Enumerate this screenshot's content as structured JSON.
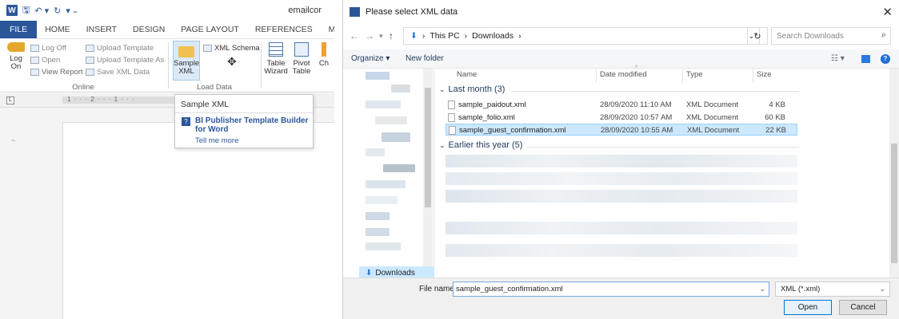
{
  "word": {
    "doc_title": "emailcor",
    "tabs": [
      "FILE",
      "HOME",
      "INSERT",
      "DESIGN",
      "PAGE LAYOUT",
      "REFERENCES",
      "MAILINGS"
    ],
    "ribbon": {
      "log_on": "Log\nOn",
      "log_off": "Log Off",
      "open": "Open",
      "view_report": "View Report",
      "upload_template": "Upload Template",
      "upload_template_as": "Upload Template As",
      "save_xml_data": "Save XML Data",
      "online_label": "Online",
      "sample_xml": "Sample\nXML",
      "xml_schema": "XML Schema",
      "load_data_label": "Load Data",
      "table_wizard": "Table\nWizard",
      "pivot_table": "Pivot\nTable",
      "chart": "Ch"
    },
    "ruler_text": "1 · · · 2 · · · 1 · · ·",
    "tooltip": {
      "title": "Sample XML",
      "link": "BI Publisher Template Builder for Word",
      "more": "Tell me more"
    }
  },
  "dialog": {
    "title": "Please select XML data",
    "path": [
      "This PC",
      "Downloads"
    ],
    "search_placeholder": "Search Downloads",
    "organize": "Organize ▾",
    "new_folder": "New folder",
    "nav_downloads": "Downloads",
    "columns": {
      "name": "Name",
      "date": "Date modified",
      "type": "Type",
      "size": "Size"
    },
    "groups": [
      {
        "label": "Last month (3)"
      },
      {
        "label": "Earlier this year (5)"
      }
    ],
    "files": [
      {
        "name": "sample_paidout.xml",
        "date": "28/09/2020 11:10 AM",
        "type": "XML Document",
        "size": "4 KB"
      },
      {
        "name": "sample_folio.xml",
        "date": "28/09/2020 10:57 AM",
        "type": "XML Document",
        "size": "60 KB"
      },
      {
        "name": "sample_guest_confirmation.xml",
        "date": "28/09/2020 10:55 AM",
        "type": "XML Document",
        "size": "22 KB"
      }
    ],
    "file_name_label": "File name:",
    "file_name_value": "sample_guest_confirmation.xml",
    "filter": "XML (*.xml)",
    "open_button": "Open",
    "cancel_button": "Cancel"
  }
}
